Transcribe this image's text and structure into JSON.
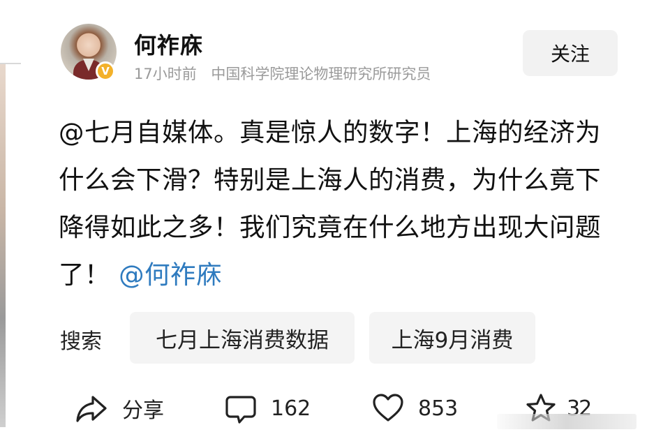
{
  "author": {
    "name": "何祚庥",
    "time": "17小时前",
    "title": "中国科学院理论物理研究所研究员",
    "badge": "V"
  },
  "follow_label": "关注",
  "post": {
    "text": "@七月自媒体。真是惊人的数字！上海的经济为什么会下滑？特别是上海人的消费，为什么竟下降得如此之多！我们究竟在什么地方出现大问题了！",
    "mention": "@何祚庥"
  },
  "search": {
    "label": "搜索",
    "chips": [
      "七月上海消费数据",
      "上海9月消费"
    ]
  },
  "actions": {
    "share_label": "分享",
    "comments": "162",
    "likes": "853",
    "favorites": "32"
  },
  "icons": {
    "share": "share-icon",
    "comment": "comment-icon",
    "like": "heart-icon",
    "favorite": "star-icon"
  },
  "colors": {
    "mention": "#2f7bbf",
    "badge": "#f3b12a",
    "chip_bg": "#f4f4f4",
    "meta": "#9a9a9a"
  }
}
